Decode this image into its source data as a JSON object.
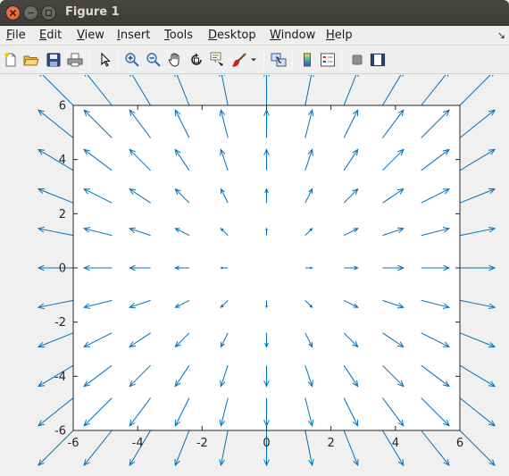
{
  "window": {
    "title": "Figure 1"
  },
  "menu": {
    "items": [
      {
        "label": "File",
        "mnemonic": "F"
      },
      {
        "label": "Edit",
        "mnemonic": "E"
      },
      {
        "label": "View",
        "mnemonic": "V"
      },
      {
        "label": "Insert",
        "mnemonic": "I"
      },
      {
        "label": "Tools",
        "mnemonic": "T"
      },
      {
        "label": "Desktop",
        "mnemonic": "D"
      },
      {
        "label": "Window",
        "mnemonic": "W"
      },
      {
        "label": "Help",
        "mnemonic": "H"
      }
    ]
  },
  "toolbar": {
    "buttons": [
      "new-figure-icon",
      "open-file-icon",
      "save-icon",
      "print-icon",
      "edit-plot-pointer-icon",
      "zoom-in-icon",
      "zoom-out-icon",
      "pan-hand-icon",
      "rotate-3d-icon",
      "data-cursor-icon",
      "brush-icon",
      "brush-dropdown-icon",
      "link-plot-icon",
      "insert-colorbar-icon",
      "insert-legend-icon",
      "hide-plot-tools-icon",
      "show-plot-tools-icon"
    ]
  },
  "colors": {
    "quiver": "#0072bd",
    "axes": "#262626",
    "background": "#f0f0f0",
    "plot_background": "#ffffff"
  },
  "chart_data": {
    "type": "quiver",
    "title": "",
    "xlabel": "",
    "ylabel": "",
    "xlim": [
      -6,
      6
    ],
    "ylim": [
      -6,
      6
    ],
    "xticks": [
      -6,
      -4,
      -2,
      0,
      2,
      4,
      6
    ],
    "yticks": [
      -6,
      -4,
      -2,
      0,
      2,
      4,
      6
    ],
    "grid": false,
    "legend": "none",
    "series": [
      {
        "grid_x": [
          -6,
          -4.8,
          -3.6,
          -2.4,
          -1.2,
          0,
          1.2,
          2.4,
          3.6,
          4.8,
          6
        ],
        "grid_y": [
          -6,
          -4.8,
          -3.6,
          -2.4,
          -1.2,
          0,
          1.2,
          2.4,
          3.6,
          4.8,
          6
        ],
        "u_formula": "x",
        "v_formula": "y",
        "autoscale": true
      }
    ]
  }
}
